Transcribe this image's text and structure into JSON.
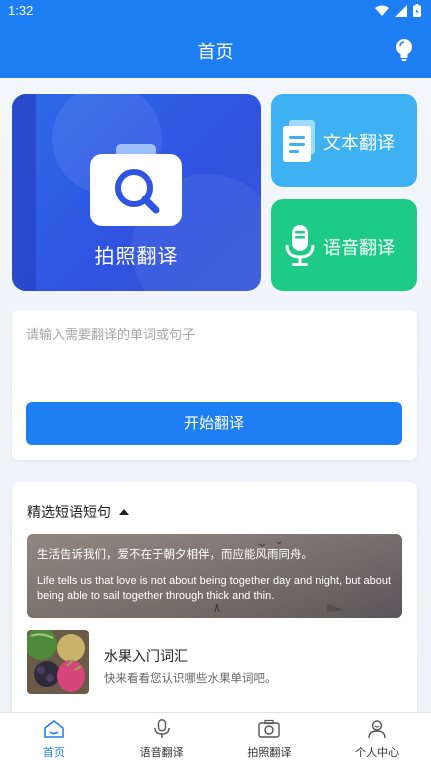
{
  "status": {
    "time": "1:32"
  },
  "header": {
    "title": "首页",
    "bulb_icon": "lightbulb-icon"
  },
  "features": {
    "photo_translate": "拍照翻译",
    "text_translate": "文本翻译",
    "voice_translate": "语音翻译"
  },
  "input": {
    "placeholder": "请输入需要翻译的单词或句子",
    "value": "",
    "button_label": "开始翻译"
  },
  "phrases": {
    "section_title": "精选短语短句",
    "quote_zh": "生活告诉我们，爱不在于朝夕相伴，而应能风雨同舟。",
    "quote_en": "Life tells us that love is not about being together day and night, but about being able to sail together through thick and thin."
  },
  "vocab": {
    "title": "水果入门词汇",
    "description": "快来看看您认识哪些水果单词吧。"
  },
  "tabs": [
    {
      "label": "首页",
      "icon": "home-icon",
      "active": true
    },
    {
      "label": "语音翻译",
      "icon": "microphone-icon",
      "active": false
    },
    {
      "label": "拍照翻译",
      "icon": "camera-icon",
      "active": false
    },
    {
      "label": "个人中心",
      "icon": "user-icon",
      "active": false
    }
  ],
  "colors": {
    "primary": "#1e7ff5",
    "photo_card": "#2f54e2",
    "text_card": "#3eb1f2",
    "voice_card": "#1ecb86"
  }
}
